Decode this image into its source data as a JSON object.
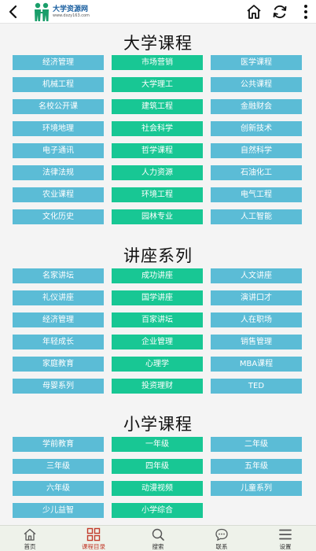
{
  "header": {
    "site_name": "大学资源网",
    "site_url": "www.dxzy163.com",
    "icons": [
      "back-arrow-icon",
      "home-icon",
      "refresh-icon",
      "more-vert-icon"
    ]
  },
  "sections": [
    {
      "title": "大学课程",
      "items": [
        "经济管理",
        "市场营销",
        "医学课程",
        "机械工程",
        "大学理工",
        "公共课程",
        "名校公开课",
        "建筑工程",
        "金融财会",
        "环境地理",
        "社会科学",
        "创新技术",
        "电子通讯",
        "哲学课程",
        "自然科学",
        "法律法规",
        "人力资源",
        "石油化工",
        "农业课程",
        "环境工程",
        "电气工程",
        "文化历史",
        "园林专业",
        "人工智能"
      ]
    },
    {
      "title": "讲座系列",
      "items": [
        "名家讲坛",
        "成功讲座",
        "人文讲座",
        "礼仪讲座",
        "国学讲座",
        "演讲口才",
        "经济管理",
        "百家讲坛",
        "人在职场",
        "年轻成长",
        "企业管理",
        "销售管理",
        "家庭教育",
        "心理学",
        "MBA课程",
        "母婴系列",
        "投资理财",
        "TED"
      ]
    },
    {
      "title": "小学课程",
      "items": [
        "学前教育",
        "一年级",
        "二年级",
        "三年级",
        "四年级",
        "五年级",
        "六年级",
        "动漫视频",
        "儿童系列",
        "少儿益智",
        "小学综合"
      ]
    }
  ],
  "colors": {
    "blue": "#5bbcd6",
    "green": "#18c794",
    "active_tab": "#c23a2a",
    "logo_text": "#1a5fa0"
  },
  "tabbar": {
    "tabs": [
      {
        "label": "首页",
        "icon": "home-icon"
      },
      {
        "label": "课程目录",
        "icon": "grid-icon"
      },
      {
        "label": "搜索",
        "icon": "search-icon"
      },
      {
        "label": "联系",
        "icon": "chat-icon"
      },
      {
        "label": "设置",
        "icon": "menu-icon"
      }
    ],
    "active": "课程目录"
  }
}
